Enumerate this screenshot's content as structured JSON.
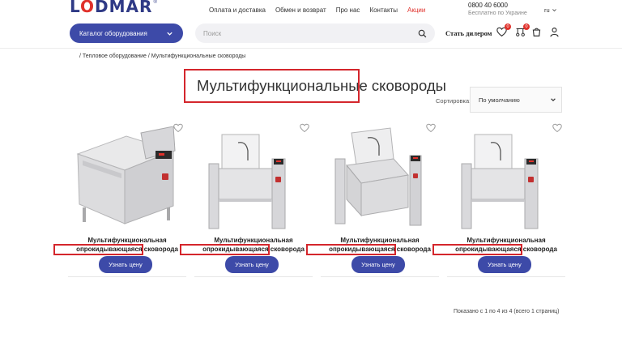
{
  "header": {
    "logo": {
      "text_before": "L",
      "text_o": "O",
      "text_after": "DMAR",
      "reg": "®"
    },
    "nav": [
      {
        "label": "Оплата и доставка"
      },
      {
        "label": "Обмен и возврат"
      },
      {
        "label": "Про нас"
      },
      {
        "label": "Контакты"
      },
      {
        "label": "Акции"
      }
    ],
    "phone": "0800 40 6000",
    "phone_sub": "Бесплатно по Украине",
    "lang": "ru",
    "catalog_label": "Каталог оборудования",
    "search_placeholder": "Поиск",
    "dealer_label": "Стать дилером",
    "wishlist_count": "0",
    "compare_count": "0"
  },
  "breadcrumb": {
    "items": [
      "/ Тепловое оборудование",
      "/ Мультифункциональные сковороды"
    ]
  },
  "page": {
    "title": "Мультифункциональные сковороды",
    "sort_label": "Сортировка:",
    "sort_value": "По умолчанию"
  },
  "products": [
    {
      "name_line1": "Мультифункциональная",
      "name_line2": "опрокидывающаяся сковорода",
      "button": "Узнать цену"
    },
    {
      "name_line1": "Мультифункциональная",
      "name_line2": "опрокидывающаяся сковорода",
      "button": "Узнать цену"
    },
    {
      "name_line1": "Мультифункциональная",
      "name_line2": "опрокидывающаяся сковорода",
      "button": "Узнать цену"
    },
    {
      "name_line1": "Мультифункциональная",
      "name_line2": "опрокидывающаяся сковорода",
      "button": "Узнать цену"
    }
  ],
  "pagination": {
    "info": "Показано с 1 по 4 из 4 (всего 1 страниц)"
  },
  "colors": {
    "brand_blue": "#3d4aa8",
    "accent_red": "#e0312b",
    "highlight_red": "#d4262c"
  },
  "icons": [
    "search-icon",
    "heart-icon",
    "compare-icon",
    "cart-icon",
    "user-icon",
    "chevron-down-icon"
  ]
}
